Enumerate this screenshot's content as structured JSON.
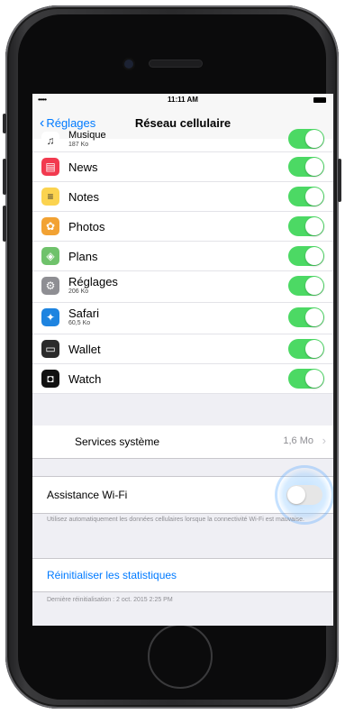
{
  "status_bar": {
    "signal": "•••••",
    "time": "11:11 AM"
  },
  "nav": {
    "back_label": "Réglages",
    "title": "Réseau cellulaire"
  },
  "apps": [
    {
      "name": "Musique",
      "size": "187 Ko",
      "icon": "music-icon",
      "color": "#ffffff",
      "enabled": true
    },
    {
      "name": "News",
      "size": "",
      "icon": "news-icon",
      "color": "#f23a4f",
      "enabled": true
    },
    {
      "name": "Notes",
      "size": "",
      "icon": "notes-icon",
      "color": "#fbd34f",
      "enabled": true
    },
    {
      "name": "Photos",
      "size": "",
      "icon": "photos-icon",
      "color": "#f2a233",
      "enabled": true
    },
    {
      "name": "Plans",
      "size": "",
      "icon": "maps-icon",
      "color": "#6fc26b",
      "enabled": true
    },
    {
      "name": "Réglages",
      "size": "206 Ko",
      "icon": "settings-icon",
      "color": "#8e8e93",
      "enabled": true
    },
    {
      "name": "Safari",
      "size": "60,5 Ko",
      "icon": "safari-icon",
      "color": "#1e84e0",
      "enabled": true
    },
    {
      "name": "Wallet",
      "size": "",
      "icon": "wallet-icon",
      "color": "#2b2b2b",
      "enabled": true
    },
    {
      "name": "Watch",
      "size": "",
      "icon": "watch-icon",
      "color": "#111111",
      "enabled": true
    }
  ],
  "system_services": {
    "label": "Services système",
    "value": "1,6 Mo"
  },
  "wifi_assist": {
    "label": "Assistance Wi-Fi",
    "enabled": false,
    "description": "Utilisez automatiquement les données cellulaires lorsque la connectivité Wi-Fi est mauvaise."
  },
  "reset": {
    "label": "Réinitialiser les statistiques",
    "last_reset": "Dernière réinitialisation : 2 oct. 2015 2:25 PM"
  },
  "colors": {
    "accent": "#007aff",
    "toggle_on": "#4cd964"
  }
}
